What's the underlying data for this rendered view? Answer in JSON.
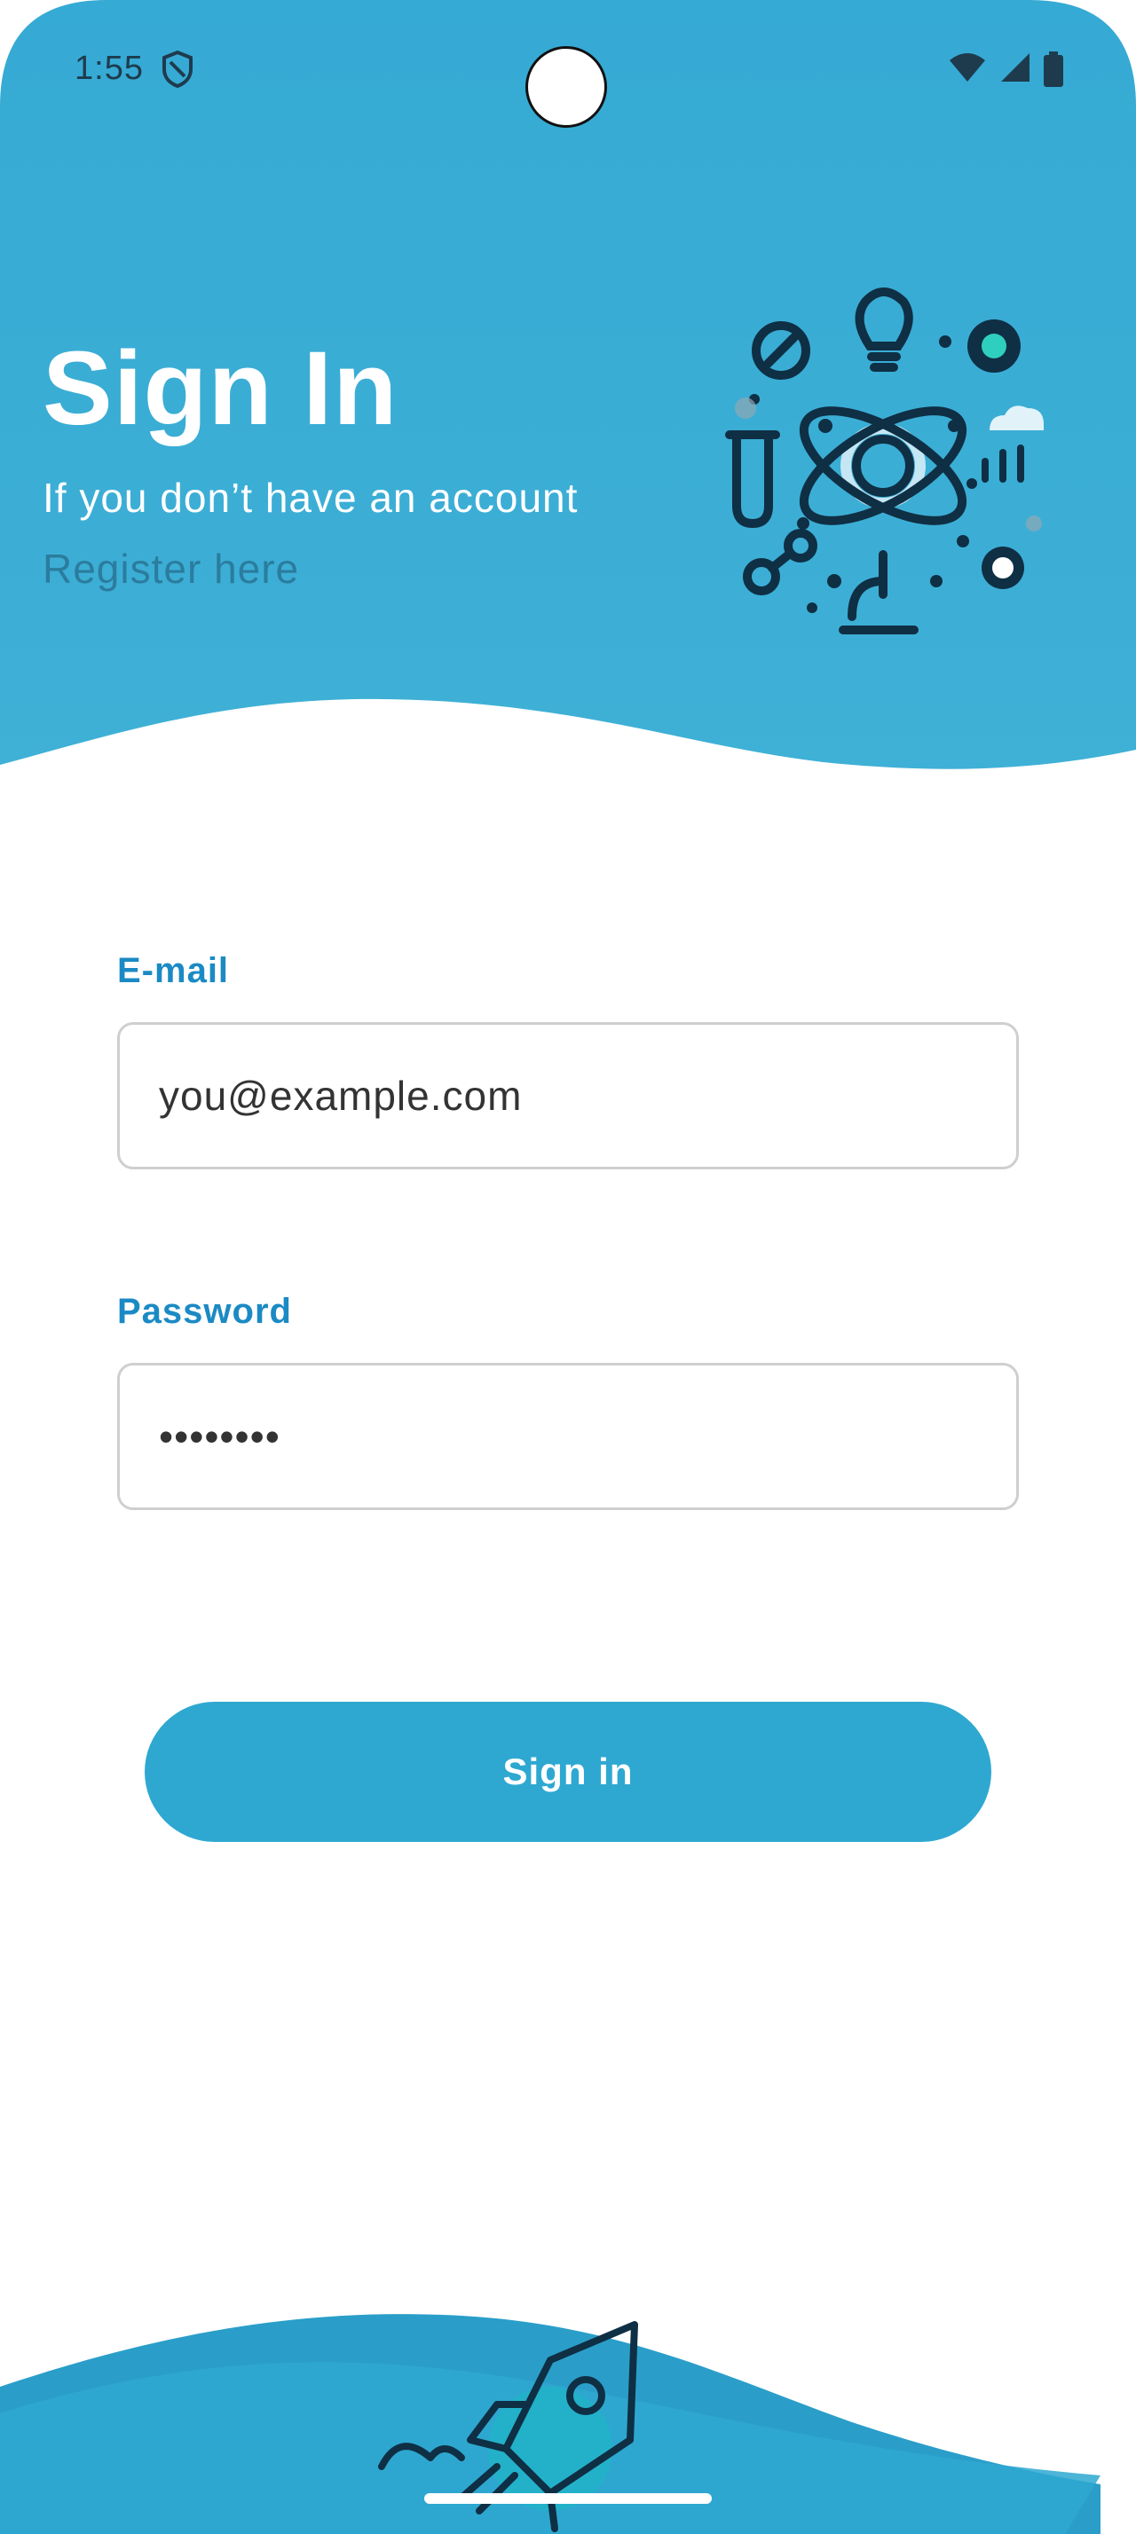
{
  "colors": {
    "header_blue": "#3aabd4",
    "accent_blue": "#1b8ac4",
    "button_blue": "#2ea8d1",
    "link_color": "#2b7c9e",
    "footer_blue": "#2a9ec9"
  },
  "status_bar": {
    "time": "1:55",
    "icons": [
      "shield-icon",
      "wifi-icon",
      "signal-icon",
      "battery-icon"
    ]
  },
  "header": {
    "title": "Sign In",
    "subtitle": "If you don’t have an account",
    "register_link": "Register here",
    "illustration": "science-illustration"
  },
  "form": {
    "email": {
      "label": "E-mail",
      "value": "you@example.com"
    },
    "password": {
      "label": "Password",
      "value": "••••••••"
    },
    "submit_label": "Sign in"
  },
  "footer": {
    "illustration": "rocket-illustration"
  }
}
